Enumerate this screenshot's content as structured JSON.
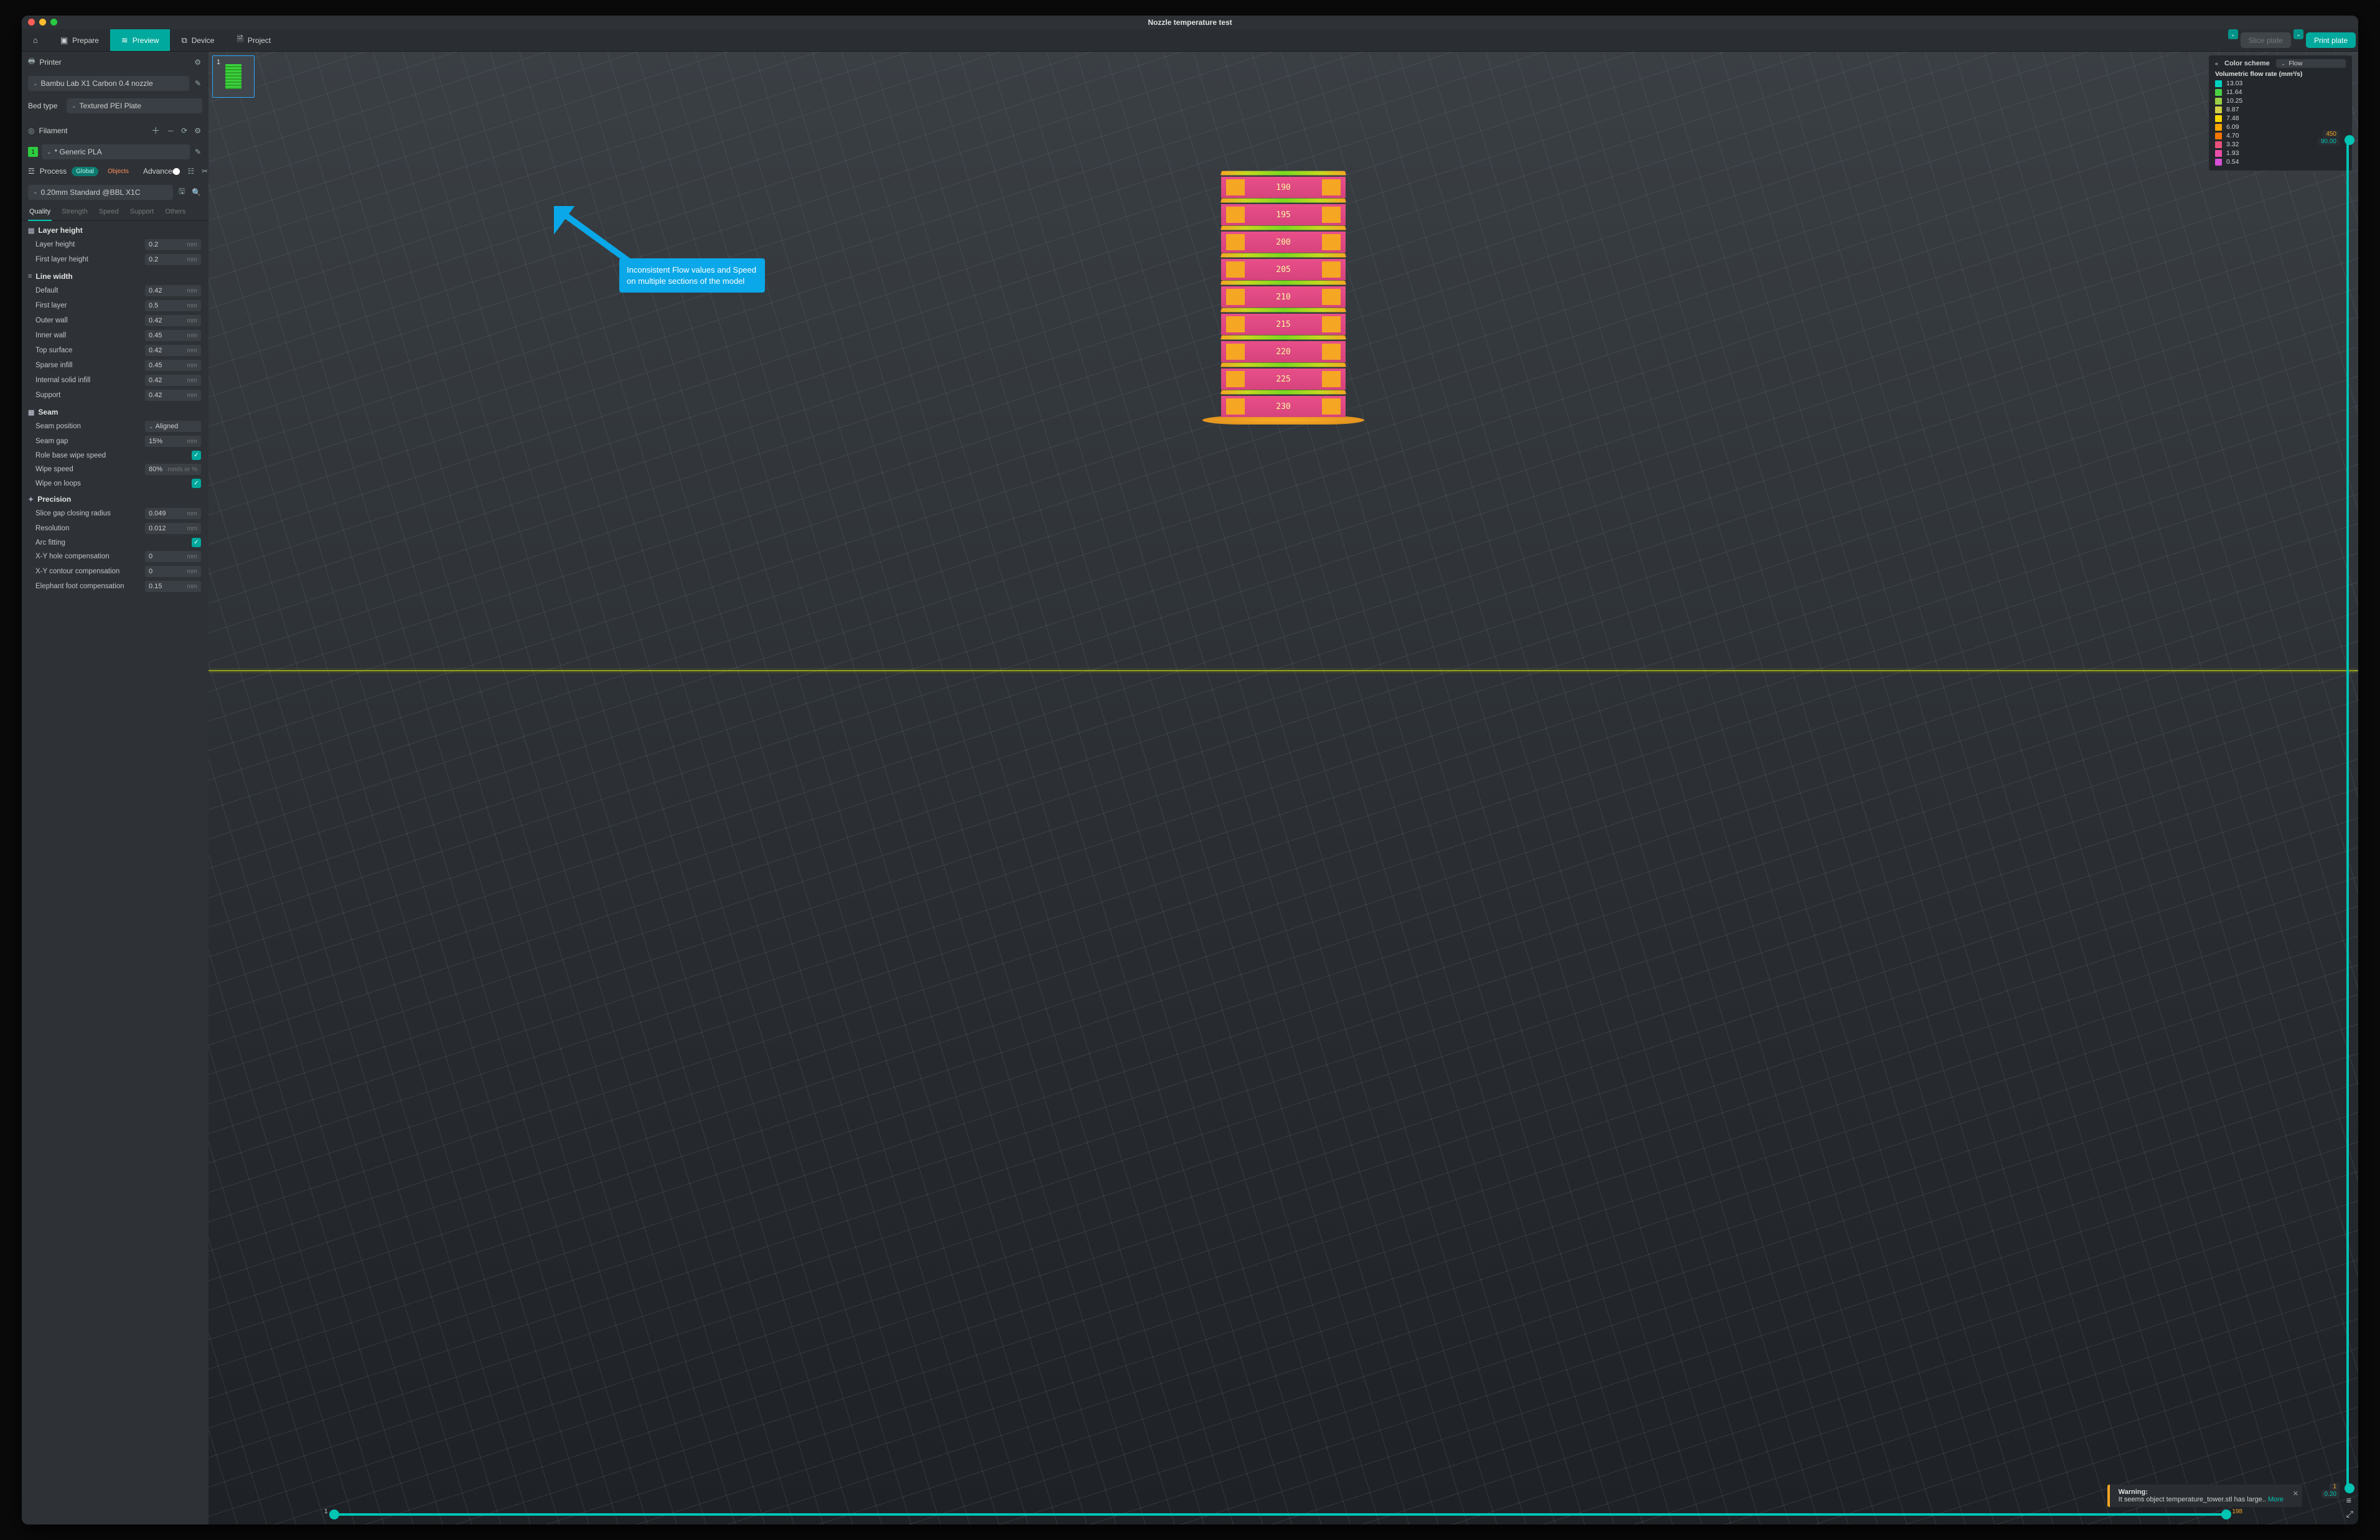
{
  "title": "Nozzle temperature test",
  "nav": {
    "prepare": "Prepare",
    "preview": "Preview",
    "device": "Device",
    "project": "Project"
  },
  "actions": {
    "slice": "Slice plate",
    "print": "Print plate"
  },
  "printer": {
    "label": "Printer",
    "value": "Bambu Lab X1 Carbon 0.4 nozzle",
    "bed_label": "Bed type",
    "bed_value": "Textured PEI Plate"
  },
  "filament": {
    "label": "Filament",
    "items": [
      {
        "index": "1",
        "name": "* Generic PLA",
        "color": "#2ecc40"
      }
    ]
  },
  "process": {
    "label": "Process",
    "global": "Global",
    "objects": "Objects",
    "advanced": "Advanced",
    "profile": "0.20mm Standard @BBL X1C",
    "tabs": {
      "quality": "Quality",
      "strength": "Strength",
      "speed": "Speed",
      "support": "Support",
      "others": "Others"
    }
  },
  "sections": {
    "layer_height": {
      "title": "Layer height",
      "params": [
        {
          "l": "Layer height",
          "v": "0.2",
          "u": "mm"
        },
        {
          "l": "First layer height",
          "v": "0.2",
          "u": "mm"
        }
      ]
    },
    "line_width": {
      "title": "Line width",
      "params": [
        {
          "l": "Default",
          "v": "0.42",
          "u": "mm"
        },
        {
          "l": "First layer",
          "v": "0.5",
          "u": "mm"
        },
        {
          "l": "Outer wall",
          "v": "0.42",
          "u": "mm"
        },
        {
          "l": "Inner wall",
          "v": "0.45",
          "u": "mm"
        },
        {
          "l": "Top surface",
          "v": "0.42",
          "u": "mm"
        },
        {
          "l": "Sparse infill",
          "v": "0.45",
          "u": "mm"
        },
        {
          "l": "Internal solid infill",
          "v": "0.42",
          "u": "mm"
        },
        {
          "l": "Support",
          "v": "0.42",
          "u": "mm"
        }
      ]
    },
    "seam": {
      "title": "Seam",
      "params": [
        {
          "l": "Seam position",
          "v": "Aligned",
          "t": "sel"
        },
        {
          "l": "Seam gap",
          "v": "15%",
          "u": "mm"
        },
        {
          "l": "Role base wipe speed",
          "t": "chk",
          "v": true
        },
        {
          "l": "Wipe speed",
          "v": "80%",
          "u": "mm/s or %"
        },
        {
          "l": "Wipe on loops",
          "t": "chk",
          "v": true
        }
      ]
    },
    "precision": {
      "title": "Precision",
      "params": [
        {
          "l": "Slice gap closing radius",
          "v": "0.049",
          "u": "mm"
        },
        {
          "l": "Resolution",
          "v": "0.012",
          "u": "mm"
        },
        {
          "l": "Arc fitting",
          "t": "chk",
          "v": true
        },
        {
          "l": "X-Y hole compensation",
          "v": "0",
          "u": "mm"
        },
        {
          "l": "X-Y contour compensation",
          "v": "0",
          "u": "mm"
        },
        {
          "l": "Elephant foot compensation",
          "v": "0.15",
          "u": "mm"
        }
      ]
    }
  },
  "plate_index": "1",
  "legend": {
    "title": "Color scheme",
    "mode": "Flow",
    "subtitle": "Volumetric flow rate (mm³/s)",
    "items": [
      {
        "c": "#00d1c1",
        "v": "13.03"
      },
      {
        "c": "#49d146",
        "v": "11.64"
      },
      {
        "c": "#9ad146",
        "v": "10.25"
      },
      {
        "c": "#d1d146",
        "v": "8.87"
      },
      {
        "c": "#f7d500",
        "v": "7.48"
      },
      {
        "c": "#f7a500",
        "v": "6.09"
      },
      {
        "c": "#f77500",
        "v": "4.70"
      },
      {
        "c": "#e94f7b",
        "v": "3.32"
      },
      {
        "c": "#e94fa8",
        "v": "1.93"
      },
      {
        "c": "#d64fd6",
        "v": "0.54"
      }
    ]
  },
  "tower_labels": [
    "190",
    "195",
    "200",
    "205",
    "210",
    "215",
    "220",
    "225",
    "230"
  ],
  "callout": "Inconsistent Flow values and Speed on multiple sections of the model",
  "warning": {
    "title": "Warning:",
    "text": "It seems object temperature_tower.stl has large..",
    "more": "More"
  },
  "vgauge": {
    "top_a": "450",
    "top_b": "90.00",
    "bot_a": "1",
    "bot_b": "0.20"
  },
  "hgauge": {
    "left": "1",
    "right": "198"
  }
}
